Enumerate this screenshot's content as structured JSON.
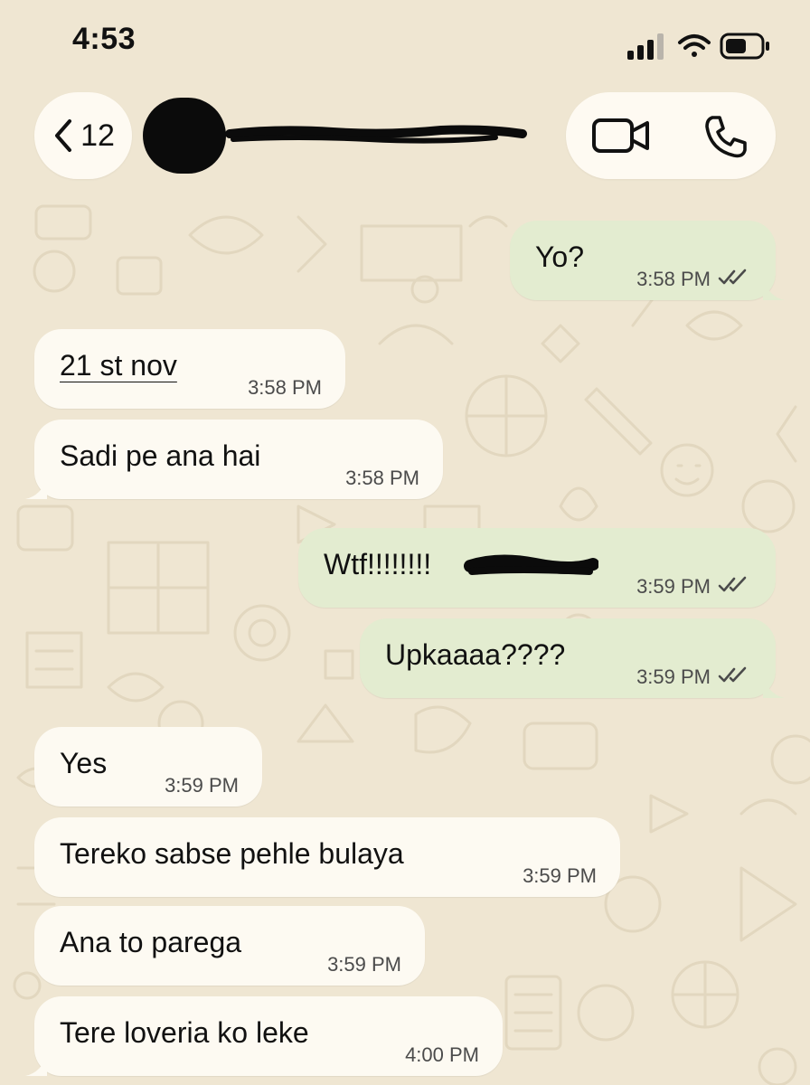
{
  "status_bar": {
    "time": "4:53",
    "signal_icon": "cellular-signal-icon",
    "wifi_icon": "wifi-icon",
    "battery_icon": "battery-icon"
  },
  "header": {
    "back_count": "12",
    "back_icon": "chevron-left-icon",
    "contact_name": "",
    "contact_name_redacted": true,
    "video_icon": "video-camera-icon",
    "phone_icon": "phone-icon"
  },
  "messages": [
    {
      "direction": "out",
      "text": "Yo?",
      "time": "3:58 PM",
      "status": "read"
    },
    {
      "direction": "in",
      "text": "21 st nov",
      "time": "3:58 PM",
      "underlined": true
    },
    {
      "direction": "in",
      "text": "Sadi pe ana hai",
      "time": "3:58 PM"
    },
    {
      "direction": "out",
      "text": "Wtf!!!!!!!!",
      "time": "3:59 PM",
      "status": "read",
      "redacted_suffix": true
    },
    {
      "direction": "out",
      "text": "Upkaaaa????",
      "time": "3:59 PM",
      "status": "read"
    },
    {
      "direction": "in",
      "text": "Yes",
      "time": "3:59 PM"
    },
    {
      "direction": "in",
      "text": "Tereko sabse pehle bulaya",
      "time": "3:59 PM"
    },
    {
      "direction": "in",
      "text": "Ana to parega",
      "time": "3:59 PM"
    },
    {
      "direction": "in",
      "text": "Tere loveria ko leke",
      "time": "4:00 PM"
    }
  ],
  "colors": {
    "background": "#efe6d2",
    "incoming_bubble": "#fdfaf2",
    "outgoing_bubble": "#e3ecd0",
    "redaction": "#0b0b0b"
  }
}
